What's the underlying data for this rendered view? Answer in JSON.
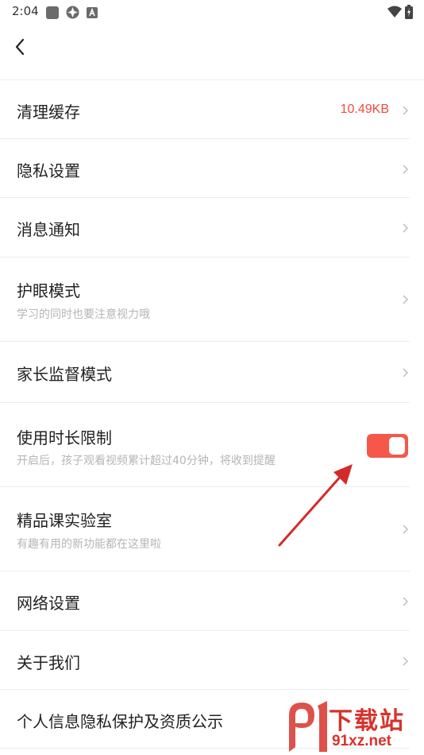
{
  "status_bar": {
    "time": "2:04",
    "icons_left": [
      "stop-square-icon",
      "aperture-icon",
      "font-a-icon"
    ],
    "icons_right": [
      "wifi-icon",
      "battery-icon"
    ]
  },
  "nav": {
    "back_icon": "chevron-left-icon"
  },
  "settings": {
    "clear_cache": {
      "label": "清理缓存",
      "value": "10.49KB"
    },
    "privacy": {
      "label": "隐私设置"
    },
    "notifications": {
      "label": "消息通知"
    },
    "eye_care": {
      "label": "护眼模式",
      "subtitle": "学习的同时也要注意视力哦"
    },
    "parental": {
      "label": "家长监督模式"
    },
    "time_limit": {
      "label": "使用时长限制",
      "subtitle": "开启后，孩子观看视频累计超过40分钟，将收到提醒",
      "enabled": true
    },
    "lab": {
      "label": "精品课实验室",
      "subtitle": "有趣有用的新功能都在这里啦"
    },
    "network": {
      "label": "网络设置"
    },
    "about": {
      "label": "关于我们"
    },
    "personal_info": {
      "label": "个人信息隐私保护及资质公示"
    }
  },
  "colors": {
    "accent": "#f5584b",
    "value_red": "#f04a3b",
    "subtitle_gray": "#b5b5b5"
  },
  "watermark": {
    "top": "下载站",
    "bottom": "91xz.net"
  }
}
